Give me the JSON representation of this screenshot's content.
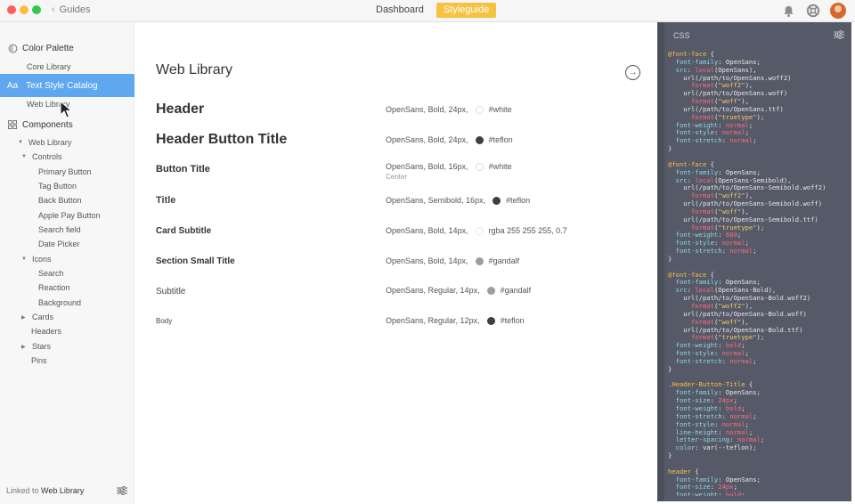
{
  "topbar": {
    "back_label": "Guides",
    "tabs": [
      {
        "label": "Dashboard",
        "active": false
      },
      {
        "label": "Styleguide",
        "active": true
      }
    ],
    "icons": [
      "notification-icon",
      "help-lifebuoy-icon",
      "user-avatar"
    ]
  },
  "colors": {
    "accent": "#f5c242",
    "selection": "#5fa8ef",
    "panel_bg": "#565a68",
    "teflon": "#3e3f45",
    "gandalf": "#9e9e9e"
  },
  "sidebar": {
    "sections": [
      {
        "label": "Color Palette",
        "icon": "palette-icon"
      },
      {
        "label": "Core Library"
      },
      {
        "label": "Text Style Catalog",
        "icon": "text-style-icon"
      },
      {
        "label": "Web Library"
      },
      {
        "label": "Components",
        "icon": "components-grid-icon"
      }
    ],
    "tree": [
      {
        "label": "Web Library",
        "expanded": true
      },
      {
        "label": "Controls",
        "expanded": true
      },
      {
        "label": "Primary Button"
      },
      {
        "label": "Tag Button"
      },
      {
        "label": "Back Button"
      },
      {
        "label": "Apple Pay Button"
      },
      {
        "label": "Search field"
      },
      {
        "label": "Date Picker"
      },
      {
        "label": "Icons",
        "expanded": true
      },
      {
        "label": "Search"
      },
      {
        "label": "Reaction"
      },
      {
        "label": "Background"
      },
      {
        "label": "Cards",
        "expanded": false
      },
      {
        "label": "Headers"
      },
      {
        "label": "Stars",
        "expanded": false
      },
      {
        "label": "Pins"
      }
    ],
    "footer_prefix": "Linked to",
    "footer_link": "Web Library"
  },
  "main": {
    "title": "Web Library",
    "styles": [
      {
        "name": "Header",
        "spec": "OpenSans, Bold, 24px,",
        "color_name": "#white",
        "dot": "#ffffff"
      },
      {
        "name": "Header Button Title",
        "spec": "OpenSans, Bold, 24px,",
        "color_name": "#teflon",
        "dot": "#3e3f45"
      },
      {
        "name": "Button Title",
        "spec": "OpenSans, Bold, 16px,",
        "color_name": "#white",
        "dot": "#ffffff",
        "sub": "Center"
      },
      {
        "name": "Title",
        "spec": "OpenSans, Semibold, 16px,",
        "color_name": "#teflon",
        "dot": "#3e3f45"
      },
      {
        "name": "Card Subtitle",
        "spec": "OpenSans, Bold, 14px,",
        "color_name": "rgba 255 255 255, 0.7",
        "dot": "#ffffff"
      },
      {
        "name": "Section Small Title",
        "spec": "OpenSans, Bold, 14px,",
        "color_name": "#gandalf",
        "dot": "#9e9e9e"
      },
      {
        "name": "Subtitle",
        "spec": "OpenSans, Regular, 14px,",
        "color_name": "#gandalf",
        "dot": "#9e9e9e"
      },
      {
        "name": "Body",
        "spec": "OpenSans, Regular, 12px,",
        "color_name": "#teflon",
        "dot": "#3e3f45"
      }
    ]
  },
  "css_panel": {
    "title": "CSS",
    "code": [
      "@font-face {",
      "  font-family: OpenSans;",
      "  src: local(OpenSans),",
      "    url(/path/to/OpenSans.woff2)",
      "      format(\"woff2\"),",
      "    url(/path/to/OpenSans.woff)",
      "      format(\"woff\"),",
      "    url(/path/to/OpenSans.ttf)",
      "      format(\"truetype\");",
      "  font-weight: normal;",
      "  font-style: normal;",
      "  font-stretch: normal;",
      "}",
      "",
      "@font-face {",
      "  font-family: OpenSans;",
      "  src: local(OpenSans-Semibold),",
      "    url(/path/to/OpenSans-Semibold.woff2)",
      "      format(\"woff2\"),",
      "    url(/path/to/OpenSans-Semibold.woff)",
      "      format(\"woff\"),",
      "    url(/path/to/OpenSans-Semibold.ttf)",
      "      format(\"truetype\");",
      "  font-weight: 600;",
      "  font-style: normal;",
      "  font-stretch: normal;",
      "}",
      "",
      "@font-face {",
      "  font-family: OpenSans;",
      "  src: local(OpenSans-Bold),",
      "    url(/path/to/OpenSans-Bold.woff2)",
      "      format(\"woff2\"),",
      "    url(/path/to/OpenSans-Bold.woff)",
      "      format(\"woff\"),",
      "    url(/path/to/OpenSans-Bold.ttf)",
      "      format(\"truetype\");",
      "  font-weight: bold;",
      "  font-style: normal;",
      "  font-stretch: normal;",
      "}",
      "",
      ".Header-Button-Title {",
      "  font-family: OpenSans;",
      "  font-size: 24px;",
      "  font-weight: bold;",
      "  font-stretch: normal;",
      "  font-style: normal;",
      "  line-height: normal;",
      "  letter-spacing: normal;",
      "  color: var(--teflon);",
      "}",
      "",
      "header {",
      "  font-family: OpenSans;",
      "  font-size: 24px;",
      "  font-weight: bold;"
    ]
  }
}
